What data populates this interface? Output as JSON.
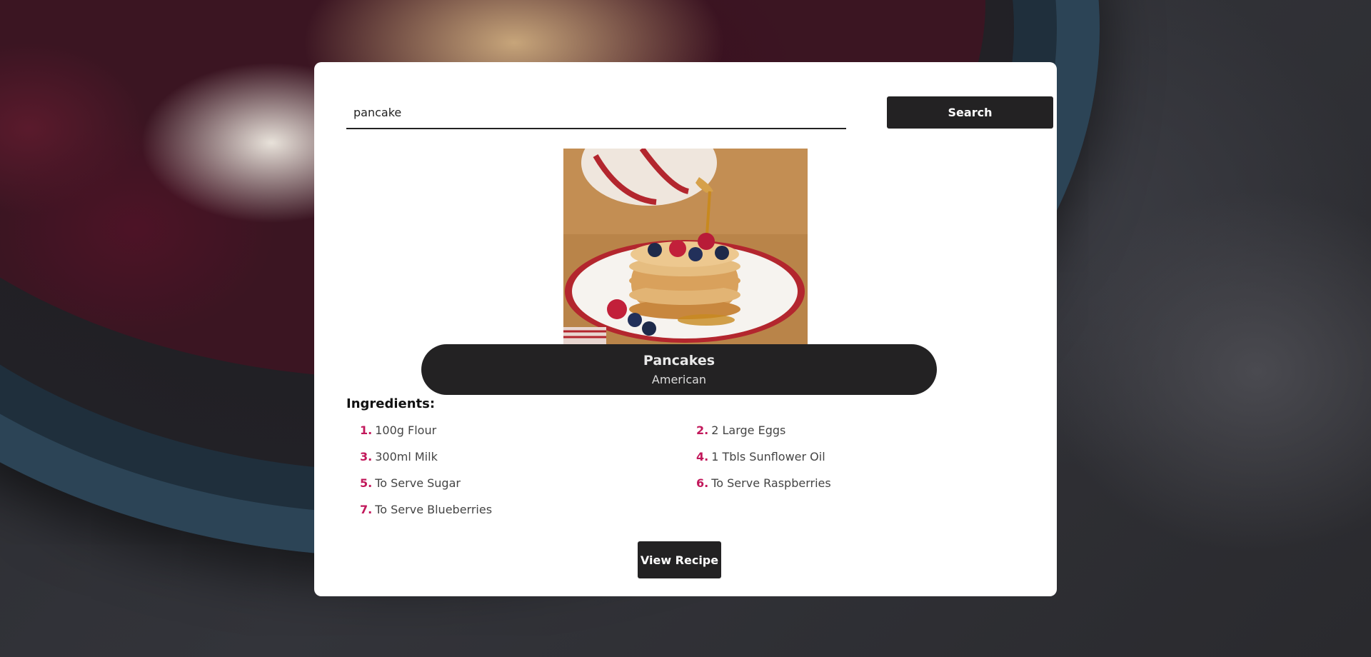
{
  "search": {
    "value": "pancake",
    "button_label": "Search"
  },
  "meal": {
    "name": "Pancakes",
    "area": "American",
    "image_icon": "pancakes-photo"
  },
  "ingredients": {
    "heading": "Ingredients:",
    "items": [
      {
        "num": "1.",
        "text": "100g Flour"
      },
      {
        "num": "2.",
        "text": "2 Large Eggs"
      },
      {
        "num": "3.",
        "text": "300ml Milk"
      },
      {
        "num": "4.",
        "text": "1 Tbls Sunflower Oil"
      },
      {
        "num": "5.",
        "text": "To Serve Sugar"
      },
      {
        "num": "6.",
        "text": "To Serve Raspberries"
      },
      {
        "num": "7.",
        "text": "To Serve Blueberries"
      }
    ]
  },
  "actions": {
    "view_recipe_label": "View Recipe"
  },
  "colors": {
    "accent_number": "#c2185b",
    "button_bg": "#232223",
    "card_bg": "#ffffff"
  }
}
